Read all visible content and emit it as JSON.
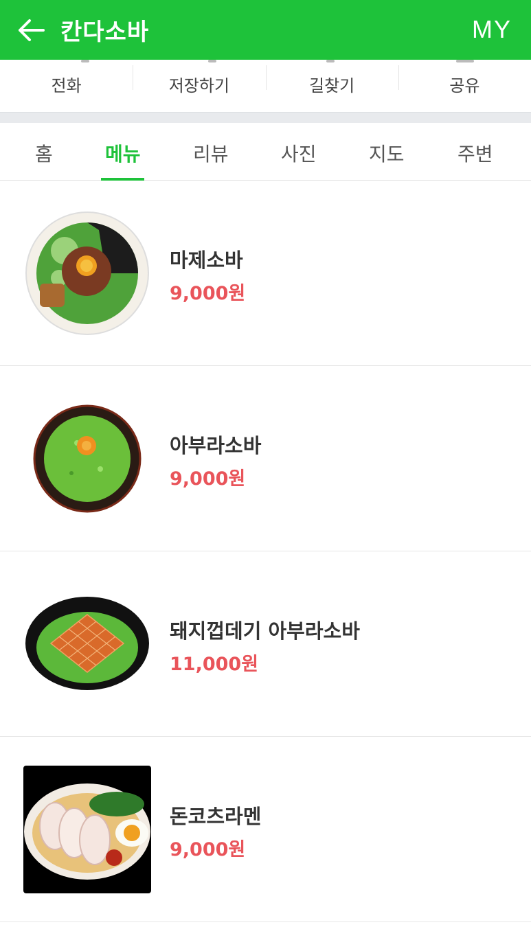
{
  "header": {
    "title": "칸다소바",
    "my_label": "MY"
  },
  "actions": [
    {
      "label": "전화",
      "icon": "phone-icon"
    },
    {
      "label": "저장하기",
      "icon": "bookmark-icon"
    },
    {
      "label": "길찾기",
      "icon": "directions-icon"
    },
    {
      "label": "공유",
      "icon": "share-icon"
    }
  ],
  "tabs": [
    {
      "label": "홈"
    },
    {
      "label": "메뉴",
      "active": true
    },
    {
      "label": "리뷰"
    },
    {
      "label": "사진"
    },
    {
      "label": "지도"
    },
    {
      "label": "주변"
    }
  ],
  "menu": [
    {
      "name": "마제소바",
      "price": "9,000원"
    },
    {
      "name": "아부라소바",
      "price": "9,000원"
    },
    {
      "name": "돼지껍데기 아부라소바",
      "price": "11,000원"
    },
    {
      "name": "돈코츠라멘",
      "price": "9,000원"
    }
  ],
  "colors": {
    "brand_green": "#1ec23a",
    "price_red": "#e9545a"
  }
}
